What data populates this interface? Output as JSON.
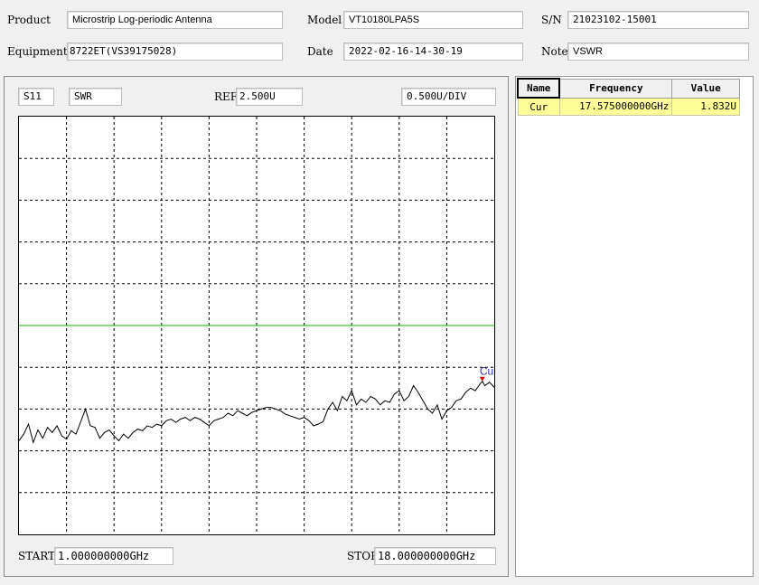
{
  "header": {
    "product_label": "Product",
    "product_value": "Microstrip Log-periodic Antenna",
    "model_label": "Model",
    "model_value": "VT10180LPA5S",
    "sn_label": "S/N",
    "sn_value": "21023102-15001",
    "equipment_label": "Equipment",
    "equipment_value": "8722ET(VS39175028)",
    "date_label": "Date",
    "date_value": "2022-02-16-14-30-19",
    "note_label": "Note",
    "note_value": "VSWR"
  },
  "chart_controls": {
    "param": "S11",
    "format": "SWR",
    "ref_label": "REF",
    "ref_value": "2.500U",
    "scale_value": "0.500U/DIV",
    "start_label": "START",
    "start_value": "1.000000000GHz",
    "stop_label": "STOP",
    "stop_value": "18.000000000GHz"
  },
  "marker_table": {
    "headers": [
      "Name",
      "Frequency",
      "Value"
    ],
    "rows": [
      {
        "name": "Cur",
        "frequency": "17.575000000GHz",
        "value": "1.832U"
      }
    ]
  },
  "chart_data": {
    "type": "line",
    "title": "",
    "xlabel": "",
    "ylabel": "",
    "xlim": [
      1.0,
      18.0
    ],
    "ylim": [
      0.0,
      5.0
    ],
    "grid": true,
    "reference_value": 2.5,
    "marker": {
      "label": "Cur",
      "x": 17.575,
      "y": 1.832
    },
    "colors": {
      "trace": "#000000",
      "reference": "#00c000",
      "marker": "#e00000",
      "marker_label": "#3030c0",
      "grid": "#000000"
    },
    "series": [
      {
        "x": [
          1.0,
          1.17,
          1.34,
          1.51,
          1.68,
          1.85,
          2.02,
          2.19,
          2.36,
          2.53,
          2.7,
          2.87,
          3.04,
          3.21,
          3.38,
          3.55,
          3.72,
          3.89,
          4.06,
          4.23,
          4.4,
          4.57,
          4.74,
          4.91,
          5.08,
          5.25,
          5.42,
          5.59,
          5.76,
          5.93,
          6.1,
          6.27,
          6.44,
          6.61,
          6.78,
          6.95,
          7.12,
          7.29,
          7.46,
          7.63,
          7.8,
          7.97,
          8.14,
          8.31,
          8.48,
          8.65,
          8.82,
          8.99,
          9.16,
          9.33,
          9.5,
          9.67,
          9.84,
          10.01,
          10.18,
          10.35,
          10.52,
          10.69,
          10.86,
          11.03,
          11.2,
          11.37,
          11.54,
          11.71,
          11.88,
          12.05,
          12.22,
          12.39,
          12.56,
          12.73,
          12.9,
          13.07,
          13.24,
          13.41,
          13.58,
          13.75,
          13.92,
          14.09,
          14.26,
          14.43,
          14.6,
          14.77,
          14.94,
          15.11,
          15.28,
          15.45,
          15.62,
          15.79,
          15.96,
          16.13,
          16.3,
          16.47,
          16.64,
          16.81,
          16.98,
          17.15,
          17.32,
          17.49,
          17.575,
          17.66,
          17.83,
          18.0
        ],
        "y": [
          1.12,
          1.2,
          1.32,
          1.1,
          1.25,
          1.15,
          1.28,
          1.22,
          1.3,
          1.18,
          1.14,
          1.24,
          1.2,
          1.35,
          1.5,
          1.3,
          1.28,
          1.15,
          1.22,
          1.25,
          1.18,
          1.12,
          1.2,
          1.15,
          1.22,
          1.26,
          1.24,
          1.3,
          1.28,
          1.32,
          1.3,
          1.36,
          1.38,
          1.34,
          1.38,
          1.4,
          1.36,
          1.4,
          1.38,
          1.34,
          1.3,
          1.36,
          1.38,
          1.4,
          1.45,
          1.42,
          1.48,
          1.45,
          1.42,
          1.46,
          1.48,
          1.5,
          1.52,
          1.52,
          1.5,
          1.48,
          1.44,
          1.42,
          1.4,
          1.38,
          1.4,
          1.36,
          1.3,
          1.32,
          1.35,
          1.5,
          1.58,
          1.48,
          1.65,
          1.6,
          1.72,
          1.55,
          1.62,
          1.58,
          1.65,
          1.62,
          1.55,
          1.6,
          1.58,
          1.68,
          1.72,
          1.6,
          1.65,
          1.78,
          1.7,
          1.6,
          1.5,
          1.45,
          1.55,
          1.38,
          1.48,
          1.52,
          1.6,
          1.62,
          1.7,
          1.75,
          1.72,
          1.8,
          1.832,
          1.78,
          1.82,
          1.76
        ]
      }
    ]
  }
}
